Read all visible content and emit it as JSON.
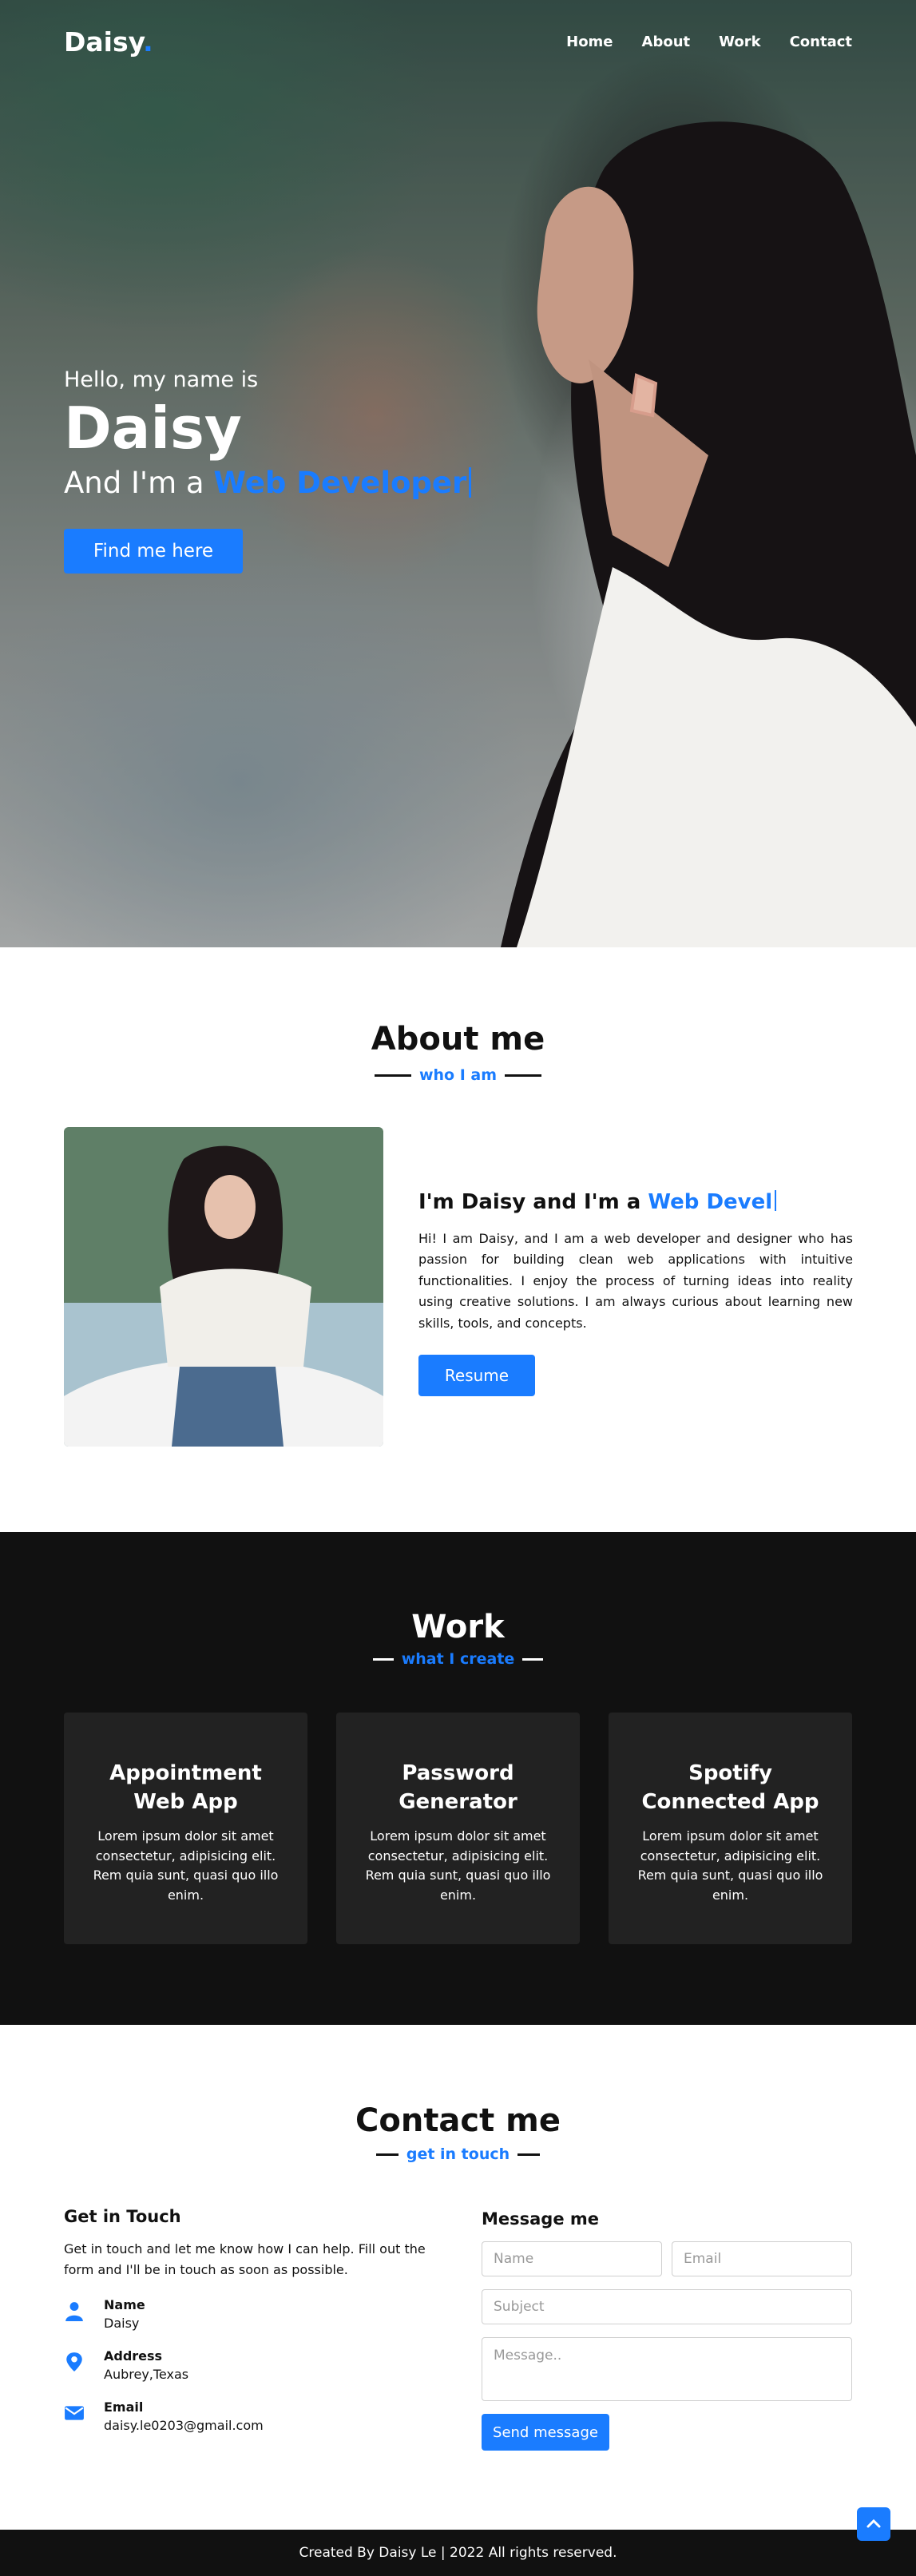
{
  "colors": {
    "accent": "#1a7cff",
    "dark": "#111111",
    "card": "#222222"
  },
  "nav": {
    "logo_text": "Daisy",
    "logo_dot": ".",
    "links": [
      "Home",
      "About",
      "Work",
      "Contact"
    ]
  },
  "hero": {
    "greeting": "Hello, my name is",
    "name": "Daisy",
    "role_prefix": "And I'm a",
    "role_typed": "Web Developer",
    "button_label": "Find me here"
  },
  "about": {
    "title": "About me",
    "subtitle": "who I am",
    "heading_prefix": "I'm Daisy and I'm a",
    "heading_typed": "Web Devel",
    "paragraph": "Hi! I am Daisy, and I am a web developer and designer who has passion for building clean web applications with intuitive functionalities. I enjoy the process of turning ideas into reality using creative solutions. I am always curious about learning new skills, tools, and concepts.",
    "button_label": "Resume"
  },
  "work": {
    "title": "Work",
    "subtitle": "what I create",
    "cards": [
      {
        "title": "Appointment Web App",
        "desc": "Lorem ipsum dolor sit amet consectetur, adipisicing elit. Rem quia sunt, quasi quo illo enim."
      },
      {
        "title": "Password Generator",
        "desc": "Lorem ipsum dolor sit amet consectetur, adipisicing elit. Rem quia sunt, quasi quo illo enim."
      },
      {
        "title": "Spotify Connected App",
        "desc": "Lorem ipsum dolor sit amet consectetur, adipisicing elit. Rem quia sunt, quasi quo illo enim."
      }
    ]
  },
  "contact": {
    "title": "Contact me",
    "subtitle": "get in touch",
    "left_heading": "Get in Touch",
    "intro": "Get in touch and let me know how I can help. Fill out the form and I'll be in touch as soon as possible.",
    "info": [
      {
        "icon": "user-icon",
        "label": "Name",
        "value": "Daisy"
      },
      {
        "icon": "map-pin-icon",
        "label": "Address",
        "value": "Aubrey,Texas"
      },
      {
        "icon": "envelope-icon",
        "label": "Email",
        "value": "daisy.le0203@gmail.com"
      }
    ],
    "form": {
      "heading": "Message me",
      "name_placeholder": "Name",
      "email_placeholder": "Email",
      "subject_placeholder": "Subject",
      "message_placeholder": "Message..",
      "send_label": "Send message"
    }
  },
  "footer": {
    "text": "Created By Daisy Le | 2022 All rights reserved."
  },
  "scroll_top_icon": "chevron-up-icon"
}
